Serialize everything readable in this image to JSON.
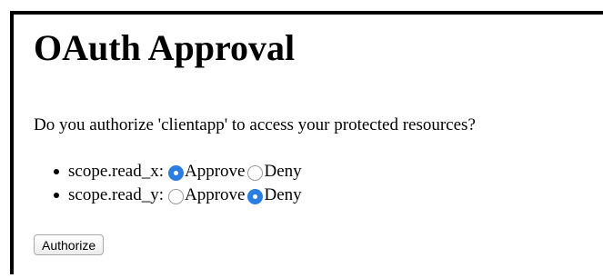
{
  "page": {
    "title": "OAuth Approval",
    "question": "Do you authorize 'clientapp' to access your protected resources?"
  },
  "scopes": [
    {
      "name": "scope.read_x:",
      "approve_label": "Approve",
      "deny_label": "Deny",
      "selected": "Approve"
    },
    {
      "name": "scope.read_y:",
      "approve_label": "Approve",
      "deny_label": "Deny",
      "selected": "Deny"
    }
  ],
  "actions": {
    "authorize_label": "Authorize"
  },
  "colors": {
    "radio_checked": "#2a7de1"
  }
}
